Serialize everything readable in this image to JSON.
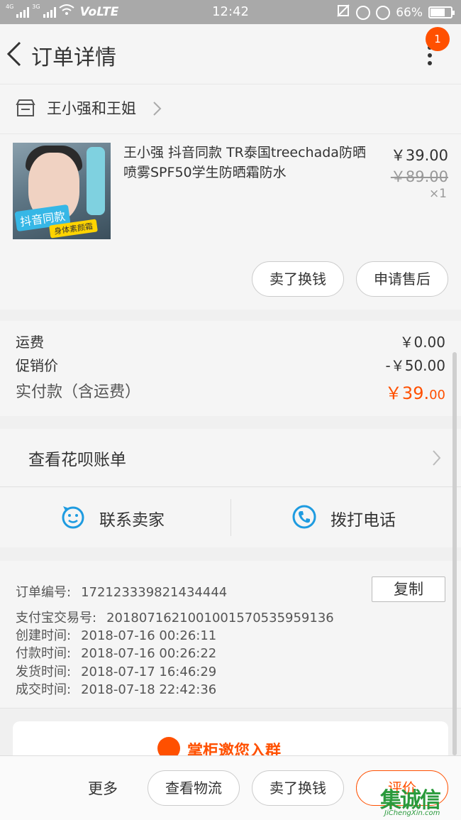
{
  "status_bar": {
    "net1": "4G",
    "net2": "3G",
    "volte": "VoLTE",
    "time": "12:42",
    "battery": "66%",
    "battery_level": 0.66
  },
  "nav": {
    "title": "订单详情",
    "badge": "1"
  },
  "shop": {
    "name": "王小强和王姐"
  },
  "product": {
    "name": "王小强 抖音同款 TR泰国treechada防晒喷雾SPF50学生防晒霜防水",
    "price": "￥39.00",
    "original_price": "￥89.00",
    "quantity": "×1",
    "image_badge_1": "抖音同款",
    "image_badge_2": "身体素颜霜",
    "buttons": {
      "sell": "卖了换钱",
      "after_sale": "申请售后"
    }
  },
  "fees": {
    "shipping_label": "运费",
    "shipping_value": "￥0.00",
    "promo_label": "促销价",
    "promo_value": "-￥50.00",
    "total_label": "实付款（含运费）",
    "total_main": "￥39.",
    "total_cents": "00"
  },
  "huabei": {
    "label": "查看花呗账单"
  },
  "contact": {
    "seller": "联系卖家",
    "phone": "拨打电话"
  },
  "order_info": {
    "copy_label": "复制",
    "lines": [
      {
        "label": "订单编号:",
        "value": "172123339821434444"
      },
      {
        "label": "支付宝交易号:",
        "value": "2018071621001001570535959136"
      },
      {
        "label": "创建时间:",
        "value": "2018-07-16 00:26:11"
      },
      {
        "label": "付款时间:",
        "value": "2018-07-16 00:26:22"
      },
      {
        "label": "发货时间:",
        "value": "2018-07-17 16:46:29"
      },
      {
        "label": "成交时间:",
        "value": "2018-07-18 22:42:36"
      }
    ]
  },
  "group": {
    "label": "掌柜邀您入群"
  },
  "bottom": {
    "more": "更多",
    "logistics": "查看物流",
    "sell": "卖了换钱",
    "rate": "评价"
  },
  "watermark": {
    "logo": "集诚信",
    "url": "JiChengXin.com"
  },
  "colors": {
    "accent": "#ff5000",
    "status_bar": "#a9a9a9",
    "background": "#f5f5f5",
    "contact_icon": "#1e9be0"
  },
  "icons": [
    "back-arrow-icon",
    "more-vertical-icon",
    "shop-icon",
    "chevron-right-icon",
    "smiley-chat-icon",
    "phone-icon",
    "group-icon"
  ]
}
